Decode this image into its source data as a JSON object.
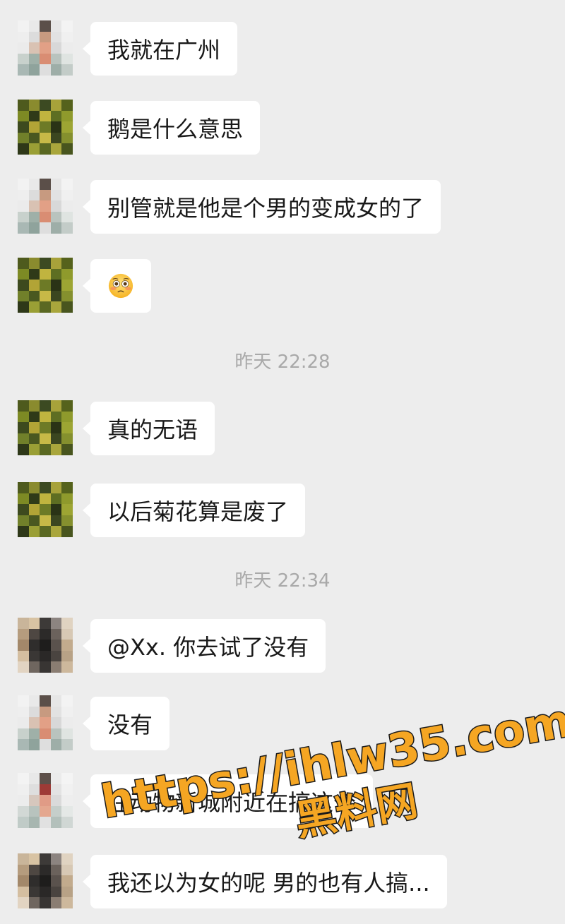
{
  "messages": [
    {
      "text": "我就在广州",
      "avatar": "white-figure"
    },
    {
      "text": "鹅是什么意思",
      "avatar": "green-yellow"
    },
    {
      "text": "别管就是他是个男的变成女的了",
      "avatar": "white-figure"
    },
    {
      "emoji": "flushed-face-emoji",
      "avatar": "green-yellow"
    },
    {
      "text": "真的无语",
      "avatar": "green-yellow"
    },
    {
      "text": "以后菊花算是废了",
      "avatar": "green-yellow"
    },
    {
      "text": "@Xx. 你去试了没有",
      "avatar": "dark-tan"
    },
    {
      "text": "没有",
      "avatar": "white-figure"
    },
    {
      "text": "在动物新城附近在搞这个",
      "avatar": "white-red"
    },
    {
      "text": "我还以为女的呢 男的也有人搞...",
      "avatar": "dark-tan"
    }
  ],
  "timestamps": [
    "昨天 22:28",
    "昨天 22:34"
  ],
  "watermark": {
    "line1": "https://ihlw35.com",
    "line2": "黑料网"
  },
  "colors": {
    "background": "#ededed",
    "bubble": "#ffffff",
    "text": "#191919",
    "timestamp": "#a9a9a9",
    "watermark_fill": "#f5a623",
    "watermark_stroke": "#1a1a1a"
  }
}
